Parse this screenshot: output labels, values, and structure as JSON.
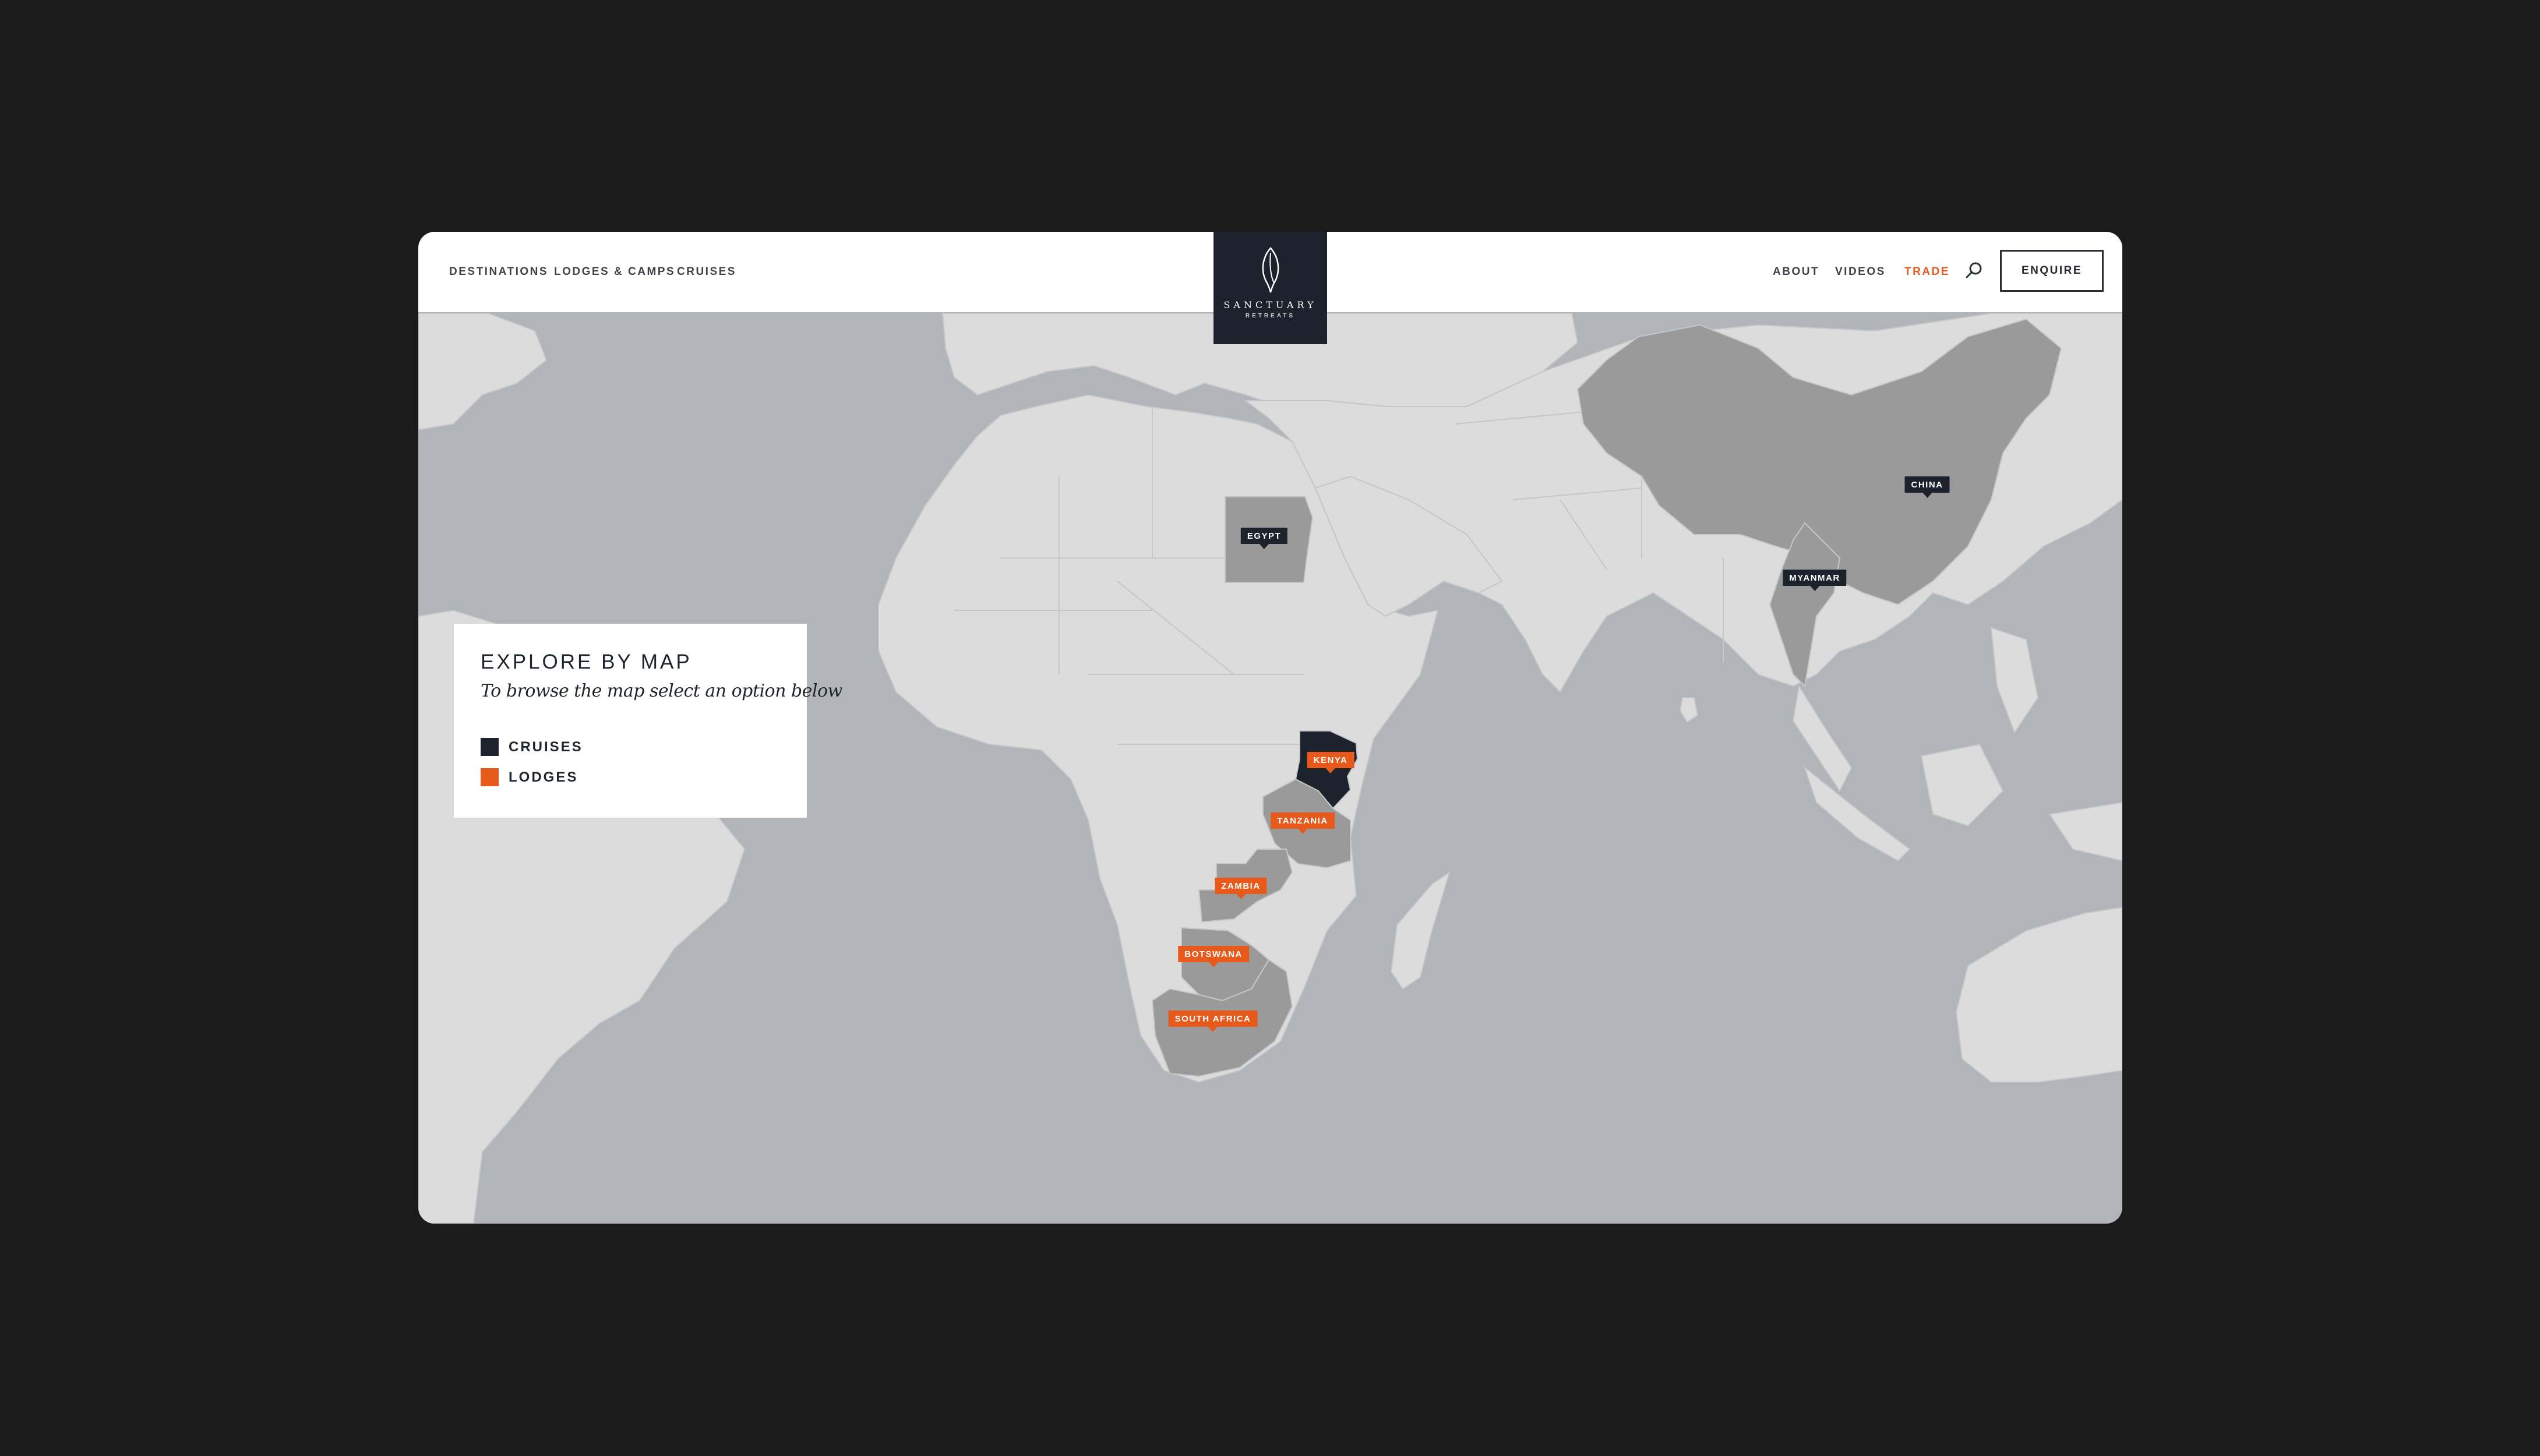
{
  "nav": {
    "left": [
      {
        "id": "destinations",
        "label": "DESTINATIONS"
      },
      {
        "id": "lodges",
        "label": "LODGES & CAMPS"
      },
      {
        "id": "cruises",
        "label": "CRUISES"
      }
    ],
    "right": [
      {
        "id": "about",
        "label": "ABOUT"
      },
      {
        "id": "videos",
        "label": "VIDEOS"
      },
      {
        "id": "trade",
        "label": "TRADE"
      }
    ],
    "enquire_label": "ENQUIRE",
    "search_icon": "search-icon"
  },
  "logo": {
    "name": "SANCTUARY",
    "sub": "RETREATS",
    "icon": "leaf-icon"
  },
  "legend": {
    "title": "EXPLORE BY MAP",
    "subtitle": "To browse the map select an option below",
    "items": [
      {
        "label": "CRUISES",
        "color": "#1c232c"
      },
      {
        "label": "LODGES",
        "color": "#e85a1b"
      }
    ]
  },
  "map": {
    "colors": {
      "ocean": "#b1b4b8",
      "land": "#dcdcdc",
      "destination": "#9a9a9a",
      "cruise": "#1c232c",
      "lodge": "#e85a1b"
    },
    "tags": {
      "egypt": {
        "label": "EGYPT",
        "type": "cruise"
      },
      "china": {
        "label": "CHINA",
        "type": "cruise"
      },
      "myanmar": {
        "label": "MYANMAR",
        "type": "cruise"
      },
      "kenya": {
        "label": "KENYA",
        "type": "lodge"
      },
      "tanzania": {
        "label": "TANZANIA",
        "type": "lodge"
      },
      "zambia": {
        "label": "ZAMBIA",
        "type": "lodge"
      },
      "botswana": {
        "label": "BOTSWANA",
        "type": "lodge"
      },
      "south_africa": {
        "label": "SOUTH AFRICA",
        "type": "lodge"
      }
    }
  }
}
